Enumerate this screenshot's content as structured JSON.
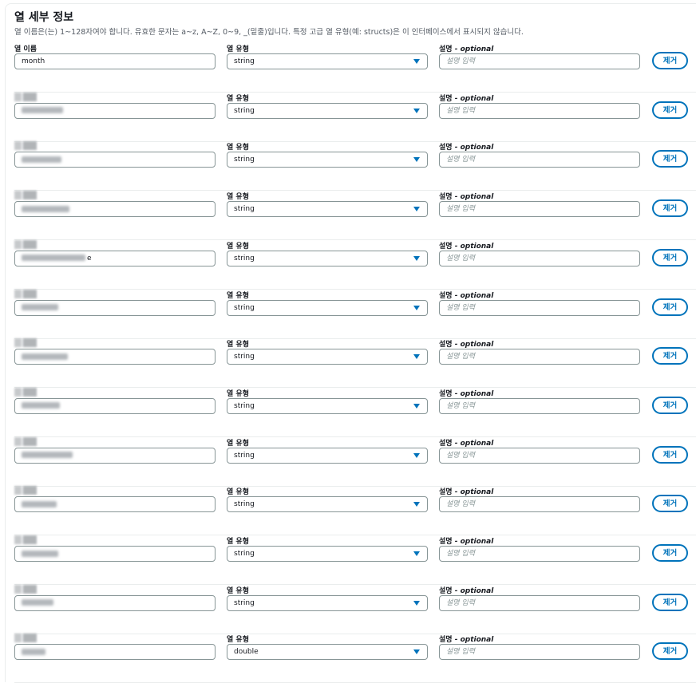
{
  "section": {
    "title": "열 세부 정보",
    "description": "열 이름은(는) 1~128자여야 합니다. 유효한 문자는 a~z, A~Z, 0~9, _(밑줄)입니다. 특정 고급 열 유형(예: structs)은 이 인터페이스에서 표시되지 않습니다."
  },
  "labels": {
    "column_name": "열 이름",
    "column_type": "열 유형",
    "description": "설명",
    "optional": " - optional",
    "description_placeholder": "설명 입력",
    "remove": "제거"
  },
  "columns": [
    {
      "name": "month",
      "type": "string"
    },
    {
      "name": "",
      "type": "string"
    },
    {
      "name": "",
      "type": "string"
    },
    {
      "name": "",
      "type": "string"
    },
    {
      "name": "e",
      "type": "string"
    },
    {
      "name": "",
      "type": "string"
    },
    {
      "name": "",
      "type": "string"
    },
    {
      "name": "",
      "type": "string"
    },
    {
      "name": "",
      "type": "string"
    },
    {
      "name": "",
      "type": "string"
    },
    {
      "name": "",
      "type": "string"
    },
    {
      "name": "",
      "type": "string"
    },
    {
      "name": "",
      "type": "double"
    }
  ],
  "colors": {
    "accent": "#0073bb",
    "border": "#879596",
    "text": "#16191f"
  }
}
